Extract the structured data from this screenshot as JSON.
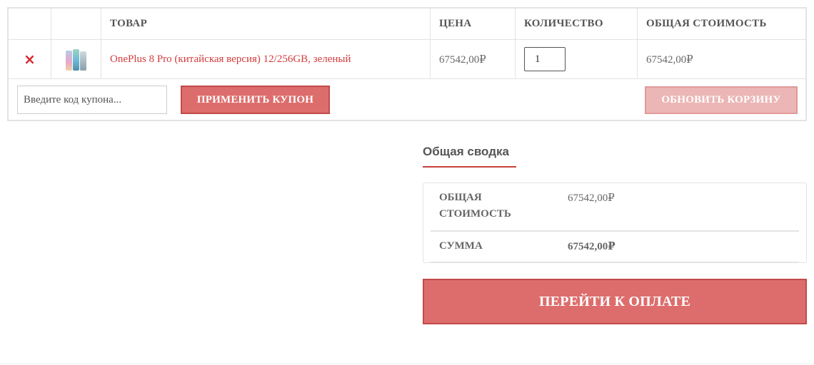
{
  "table": {
    "headers": {
      "product": "ТОВАР",
      "price": "ЦЕНА",
      "quantity": "КОЛИЧЕСТВО",
      "subtotal": "ОБЩАЯ СТОИМОСТЬ"
    },
    "item": {
      "remove_symbol": "×",
      "thumbnail_icon": "phone-thumbnail",
      "name": "OnePlus 8 Pro (китайская версия) 12/256GB, зеленый",
      "price": "67542,00₽",
      "quantity": "1",
      "subtotal": "67542,00₽"
    },
    "actions": {
      "coupon_placeholder": "Введите код купона...",
      "apply_coupon_label": "ПРИМЕНИТЬ КУПОН",
      "update_cart_label": "ОБНОВИТЬ КОРЗИНУ"
    }
  },
  "totals": {
    "title": "Общая сводка",
    "subtotal_label": "ОБЩАЯ СТОИМОСТЬ",
    "subtotal_value": "67542,00₽",
    "total_label": "СУММА",
    "total_value": "67542,00₽",
    "checkout_label": "ПЕРЕЙТИ К ОПЛАТЕ"
  },
  "colors": {
    "accent": "#dd6d6c",
    "accent_border": "#c24a4a",
    "link": "#d33d3d",
    "remove": "#d9262b",
    "disabled_button": "#ebb6b5"
  }
}
